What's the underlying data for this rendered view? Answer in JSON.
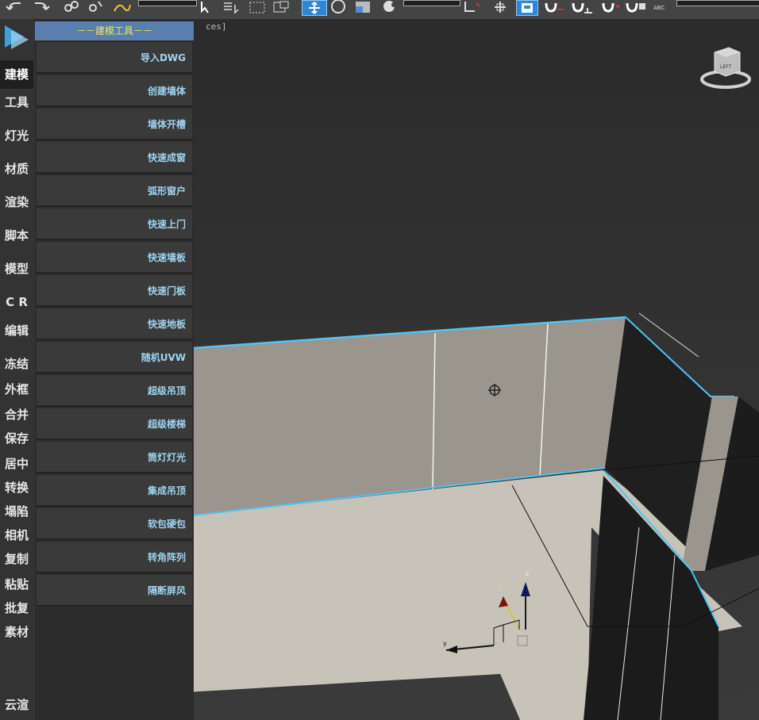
{
  "toolbar": {
    "selection_filter": "",
    "named_selection": "",
    "text_label": "ABC"
  },
  "viewport": {
    "label": "ces]",
    "viewcube_label": "LEFT"
  },
  "rail": {
    "items": [
      {
        "label": "建模",
        "active": true
      },
      {
        "label": "工具"
      },
      {
        "label": "灯光"
      },
      {
        "label": "材质"
      },
      {
        "label": "渲染"
      },
      {
        "label": "脚本"
      },
      {
        "label": "模型"
      },
      {
        "label": "C R"
      },
      {
        "label": "编辑"
      },
      {
        "label": "冻结"
      },
      {
        "label": "外框"
      },
      {
        "label": "合并"
      },
      {
        "label": "保存"
      },
      {
        "label": "居中"
      },
      {
        "label": "转换"
      },
      {
        "label": "塌陷"
      },
      {
        "label": "相机"
      },
      {
        "label": "复制"
      },
      {
        "label": "粘贴"
      },
      {
        "label": "批复"
      },
      {
        "label": "素材"
      },
      {
        "label": "云渲"
      }
    ]
  },
  "panel": {
    "title": "－－建模工具－－",
    "buttons": [
      "导入DWG",
      "创建墙体",
      "墙体开槽",
      "快速成窗",
      "弧形窗户",
      "快速上门",
      "快速墙板",
      "快速门板",
      "快速地板",
      "随机UVW",
      "超级吊顶",
      "超级楼梯",
      "筒灯灯光",
      "集成吊顶",
      "软包硬包",
      "转角阵列",
      "隔断屏风"
    ]
  },
  "gizmo": {
    "x": "x",
    "y": "y",
    "z": "z"
  },
  "colors": {
    "accent": "#5a7fae",
    "panel_text": "#9fd4f0",
    "title_text": "#f2e94e",
    "selection": "#4fc3f7"
  }
}
